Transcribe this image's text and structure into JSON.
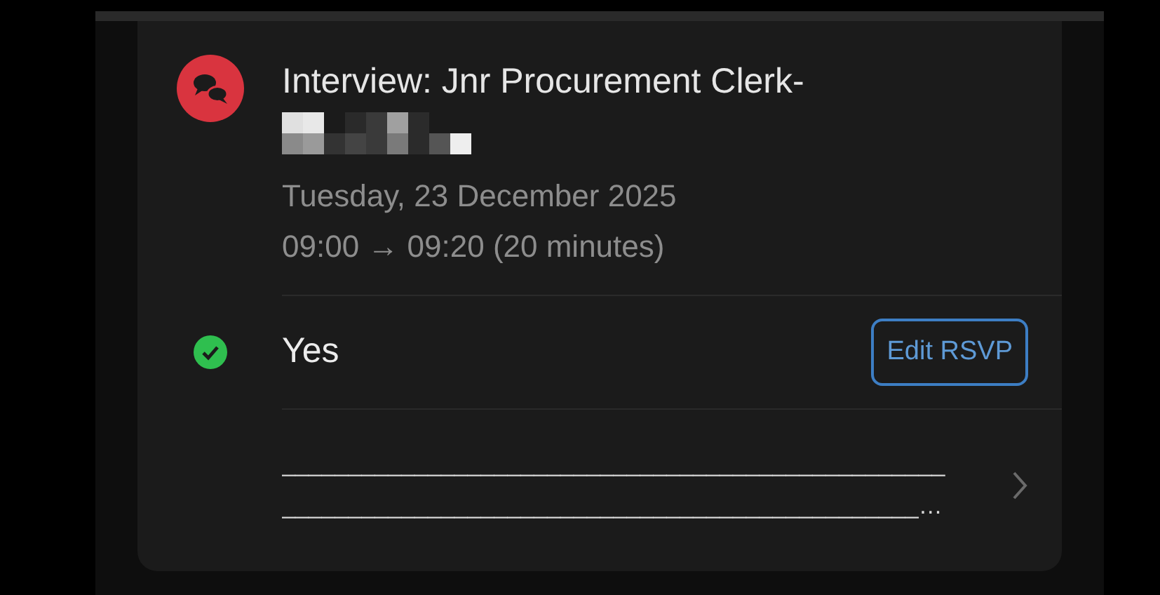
{
  "event": {
    "title": "Interview: Jnr Procurement Clerk-",
    "date": "Tuesday, 23 December 2025",
    "time": "09:00 → 09:20 (20 minutes)"
  },
  "rsvp": {
    "response": "Yes",
    "accepted": true,
    "button": "Edit RSVP"
  },
  "description": {
    "lines": [
      "__________________________________________________",
      "________________________________________________…"
    ]
  }
}
